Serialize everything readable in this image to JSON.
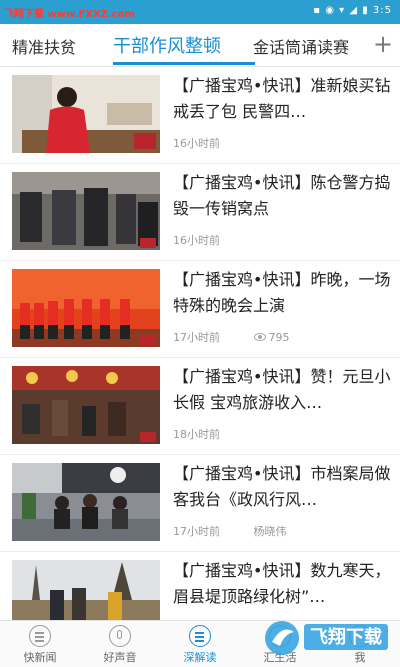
{
  "status_bar": {
    "watermark": "飞翔下载 www.FXXZ.com",
    "right": "▪ ◉ ▾ ◢ ▮ 3:5"
  },
  "tabs": [
    {
      "label": "精准扶贫"
    },
    {
      "label": "干部作风整顿"
    },
    {
      "label": "金话筒诵读赛"
    }
  ],
  "add_tab_icon": "plus-icon",
  "news": [
    {
      "title": "【广播宝鸡•快讯】准新娘买钻戒丢了包 民警四…",
      "time": "16小时前",
      "extra": ""
    },
    {
      "title": "【广播宝鸡•快讯】陈仓警方捣毁一传销窝点",
      "time": "16小时前",
      "extra": ""
    },
    {
      "title": "【广播宝鸡•快讯】昨晚，一场特殊的晚会上演",
      "time": "17小时前",
      "extra": "795"
    },
    {
      "title": "【广播宝鸡•快讯】赞！元旦小长假 宝鸡旅游收入…",
      "time": "18小时前",
      "extra": ""
    },
    {
      "title": "【广播宝鸡•快讯】市档案局做客我台《政风行风…",
      "time": "17小时前",
      "extra": "杨晓伟"
    },
    {
      "title": "【广播宝鸡•快讯】数九寒天，眉县堤顶路绿化树”…",
      "time": "",
      "extra": ""
    }
  ],
  "bottom_nav": [
    {
      "label": "快新闻",
      "icon": "newspaper-icon"
    },
    {
      "label": "好声音",
      "icon": "microphone-icon"
    },
    {
      "label": "深解读",
      "icon": "menu-lines-icon",
      "active": true
    },
    {
      "label": "汇生活",
      "icon": "life-icon"
    },
    {
      "label": "我",
      "icon": "user-icon"
    }
  ],
  "watermark_logo": "飞翔下载",
  "colors": {
    "accent": "#1a8fd0",
    "status_bar": "#2c9fd1"
  }
}
